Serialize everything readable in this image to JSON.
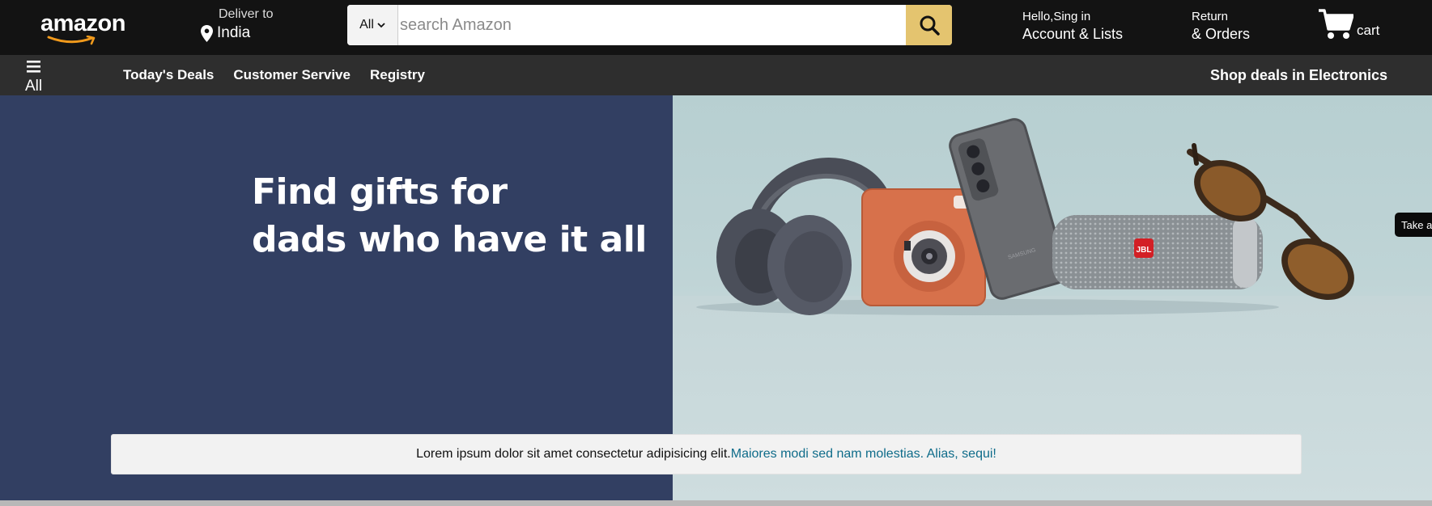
{
  "header": {
    "logo_text": "amazon",
    "deliver_label": "Deliver to",
    "deliver_location": "India",
    "search": {
      "category": "All",
      "placeholder": "search Amazon",
      "value": ""
    },
    "account": {
      "greeting": "Hello,Sing in",
      "label": "Account & Lists"
    },
    "orders": {
      "line1": "Return",
      "line2": "& Orders"
    },
    "cart_label": "cart"
  },
  "subnav": {
    "all_label": "All",
    "links": [
      "Today's Deals",
      "Customer Servive",
      "Registry"
    ],
    "promo": "Shop deals in Electronics"
  },
  "hero": {
    "headline_line1": "Find gifts for",
    "headline_line2": "dads who have it all",
    "speaker_brand": "JBL",
    "phone_brand": "SAMSUNG"
  },
  "side_tab": "Take a",
  "notice": {
    "text": "Lorem ipsum dolor sit amet consectetur adipisicing elit.",
    "link": "Maiores modi sed nam molestias. Alias, sequi!"
  },
  "colors": {
    "header_bg": "#131313",
    "subnav_bg": "#2e2e2e",
    "search_button": "#e4c46f",
    "hero_left": "#323f62",
    "hero_right": "#bfd4d6",
    "link": "#0f6c8a"
  },
  "icons": [
    "location-pin-icon",
    "chevron-down-icon",
    "search-icon",
    "cart-icon",
    "hamburger-icon"
  ]
}
